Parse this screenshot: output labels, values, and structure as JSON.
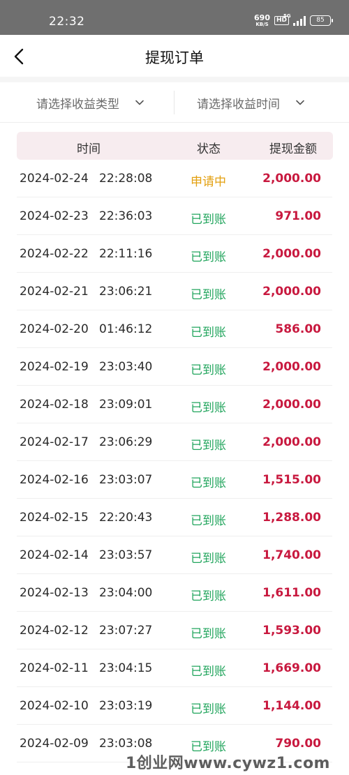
{
  "status_bar": {
    "time": "22:32",
    "net_speed": "690",
    "net_unit": "KB/S",
    "hd": "HD",
    "signal_tag": "5G",
    "battery": "85"
  },
  "navbar": {
    "back_icon": "chevron-left-icon",
    "title": "提现订单"
  },
  "filters": {
    "type_placeholder": "请选择收益类型",
    "time_placeholder": "请选择收益时间",
    "chevron_icon": "chevron-down-icon"
  },
  "table": {
    "headers": {
      "time": "时间",
      "status": "状态",
      "amount": "提现金额"
    },
    "rows": [
      {
        "date": "2024-02-24",
        "time": "22:28:08",
        "status": "申请中",
        "amount": "2,000.00"
      },
      {
        "date": "2024-02-23",
        "time": "22:36:03",
        "status": "已到账",
        "amount": "971.00"
      },
      {
        "date": "2024-02-22",
        "time": "22:11:16",
        "status": "已到账",
        "amount": "2,000.00"
      },
      {
        "date": "2024-02-21",
        "time": "23:06:21",
        "status": "已到账",
        "amount": "2,000.00"
      },
      {
        "date": "2024-02-20",
        "time": "01:46:12",
        "status": "已到账",
        "amount": "586.00"
      },
      {
        "date": "2024-02-19",
        "time": "23:03:40",
        "status": "已到账",
        "amount": "2,000.00"
      },
      {
        "date": "2024-02-18",
        "time": "23:09:01",
        "status": "已到账",
        "amount": "2,000.00"
      },
      {
        "date": "2024-02-17",
        "time": "23:06:29",
        "status": "已到账",
        "amount": "2,000.00"
      },
      {
        "date": "2024-02-16",
        "time": "23:03:07",
        "status": "已到账",
        "amount": "1,515.00"
      },
      {
        "date": "2024-02-15",
        "time": "22:20:43",
        "status": "已到账",
        "amount": "1,288.00"
      },
      {
        "date": "2024-02-14",
        "time": "23:03:57",
        "status": "已到账",
        "amount": "1,740.00"
      },
      {
        "date": "2024-02-13",
        "time": "23:04:00",
        "status": "已到账",
        "amount": "1,611.00"
      },
      {
        "date": "2024-02-12",
        "time": "23:07:27",
        "status": "已到账",
        "amount": "1,593.00"
      },
      {
        "date": "2024-02-11",
        "time": "23:04:15",
        "status": "已到账",
        "amount": "1,669.00"
      },
      {
        "date": "2024-02-10",
        "time": "23:03:19",
        "status": "已到账",
        "amount": "1,144.00"
      },
      {
        "date": "2024-02-09",
        "time": "23:03:08",
        "status": "已到账",
        "amount": "790.00"
      }
    ]
  },
  "colors": {
    "amount": "#c8193f",
    "status_done": "#22a55d",
    "status_pending": "#e3a010",
    "header_bg": "#f7ecef"
  },
  "watermark": "1创业网www.cywz1.com"
}
